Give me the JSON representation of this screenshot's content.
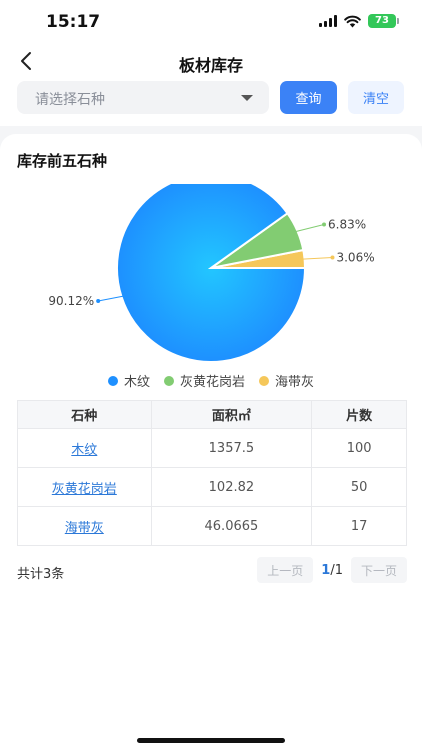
{
  "status_bar": {
    "time": "15:17",
    "battery": "73"
  },
  "header": {
    "title": "板材库存",
    "select_placeholder": "请选择石种",
    "query_label": "查询",
    "clear_label": "清空"
  },
  "section": {
    "title": "库存前五石种"
  },
  "chart_data": {
    "type": "pie",
    "categories": [
      "木纹",
      "灰黄花岗岩",
      "海带灰"
    ],
    "values": [
      90.12,
      6.83,
      3.06
    ],
    "labels": [
      "90.12%",
      "6.83%",
      "3.06%"
    ],
    "colors": [
      "#1e90ff",
      "#82cc72",
      "#f5c75a"
    ],
    "legend_position": "bottom"
  },
  "table": {
    "headers": [
      "石种",
      "面积㎡",
      "片数"
    ],
    "rows": [
      [
        "木纹",
        "1357.5",
        "100"
      ],
      [
        "灰黄花岗岩",
        "102.82",
        "50"
      ],
      [
        "海带灰",
        "46.0665",
        "17"
      ]
    ]
  },
  "footer": {
    "total": "共计3条",
    "prev": "上一页",
    "next": "下一页",
    "current_page": "1",
    "page_sep": "/",
    "total_pages": "1"
  }
}
